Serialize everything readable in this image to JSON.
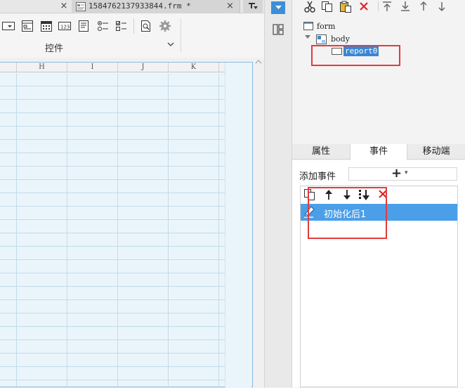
{
  "designer": {
    "file_tab": {
      "title": "1584762137933844.frm *",
      "close_glyph": "×"
    },
    "prev_tab_close_glyph": "×",
    "toolbar": {
      "icons": [
        "dropdown-box-icon",
        "window-form-icon",
        "calendar-icon",
        "number-field-icon",
        "text-area-icon",
        "radio-group-icon",
        "checkbox-group-icon",
        "search-preview-icon",
        "gear-icon"
      ],
      "widgets_label": "控件"
    },
    "sheet": {
      "columns": [
        "H",
        "I",
        "J",
        "K"
      ]
    }
  },
  "right_panel": {
    "toolbar_icons": [
      "cut-icon",
      "copy-icon",
      "paste-icon",
      "delete-icon",
      "move-top-icon",
      "move-bottom-icon",
      "move-up-icon",
      "move-down-icon"
    ],
    "tree": {
      "root": "form",
      "child": "body",
      "leaf": "report0"
    },
    "tabs": [
      {
        "label": "属性",
        "active": false
      },
      {
        "label": "事件",
        "active": true
      },
      {
        "label": "移动端",
        "active": false
      }
    ],
    "events": {
      "add_label": "添加事件",
      "add_button_glyph": "+",
      "add_button_caret": "▾",
      "list_toolbar_icons": [
        "copy-icon",
        "arrow-up-icon",
        "arrow-down-icon",
        "sort-down-icon",
        "delete-icon"
      ],
      "items": [
        {
          "label": "初始化后1",
          "selected": true
        }
      ]
    }
  },
  "colors": {
    "accent": "#3c8fd6",
    "selection": "#4b9fe8",
    "highlight_box": "#e33b3b",
    "sheet_bg": "#eaf5fb",
    "delete_red": "#e0242c"
  }
}
